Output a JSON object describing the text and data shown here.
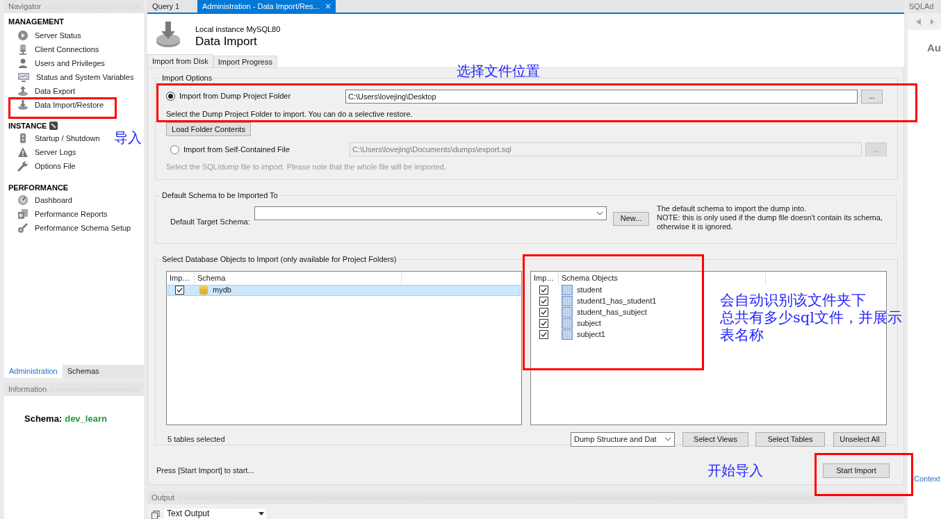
{
  "navigator": {
    "title": "Navigator",
    "sections": [
      {
        "title": "MANAGEMENT",
        "kind": "plain",
        "items": [
          {
            "label": "Server Status",
            "kind": "play"
          },
          {
            "label": "Client Connections",
            "kind": "connections"
          },
          {
            "label": "Users and Privileges",
            "kind": "user"
          },
          {
            "label": "Status and System Variables",
            "kind": "monitor"
          },
          {
            "label": "Data Export",
            "kind": "export"
          },
          {
            "label": "Data Import/Restore",
            "kind": "import"
          }
        ]
      },
      {
        "title": "INSTANCE",
        "kind": "instance",
        "items": [
          {
            "label": "Startup / Shutdown",
            "kind": "startup"
          },
          {
            "label": "Server Logs",
            "kind": "warning"
          },
          {
            "label": "Options File",
            "kind": "wrench"
          }
        ]
      },
      {
        "title": "PERFORMANCE",
        "kind": "plain",
        "items": [
          {
            "label": "Dashboard",
            "kind": "gauge"
          },
          {
            "label": "Performance Reports",
            "kind": "reports"
          },
          {
            "label": "Performance Schema Setup",
            "kind": "setup"
          }
        ]
      }
    ]
  },
  "sidebar_tabs": [
    {
      "label": "Administration",
      "selected": true
    },
    {
      "label": "Schemas",
      "selected": false
    }
  ],
  "information": {
    "title": "Information",
    "label": "Schema:",
    "value": "dev_learn"
  },
  "editor_tabs": [
    {
      "label": "Query 1",
      "selected": false,
      "closable": false
    },
    {
      "label": "Administration - Data Import/Res...",
      "selected": true,
      "closable": true
    }
  ],
  "page": {
    "instance": "Local instance MySQL80",
    "title": "Data Import"
  },
  "subtabs": [
    {
      "label": "Import from Disk",
      "selected": true
    },
    {
      "label": "Import Progress",
      "selected": false
    }
  ],
  "import_options": {
    "title": "Import Options",
    "options": [
      {
        "label": "Import from Dump Project Folder",
        "selected": true,
        "disabled": false,
        "path": "C:\\Users\\lovejing\\Desktop",
        "browse": "...",
        "hint": "Select the Dump Project Folder to import. You can do a selective restore.",
        "button": "Load Folder Contents"
      },
      {
        "label": "Import from Self-Contained File",
        "selected": false,
        "disabled": true,
        "path": "C:\\Users\\lovejing\\Documents\\dumps\\export.sql",
        "browse": "...",
        "hint": "Select the SQL/dump file to import. Please note that the whole file will be imported."
      }
    ]
  },
  "default_schema": {
    "title": "Default Schema to be Imported To",
    "label": "Default Target Schema:",
    "new_button": "New...",
    "note": [
      "The default schema to import the dump into.",
      "NOTE: this is only used if the dump file doesn't contain its schema,",
      "otherwise it is ignored."
    ]
  },
  "objects": {
    "title": "Select Database Objects to Import (only available for Project Folders)",
    "schemas": {
      "columns": [
        "Imp…",
        "Schema"
      ],
      "rows": [
        {
          "checked": true,
          "selected": true,
          "name": "mydb"
        }
      ]
    },
    "tables": {
      "columns": [
        "Imp…",
        "Schema Objects"
      ],
      "rows": [
        {
          "checked": true,
          "name": "student"
        },
        {
          "checked": true,
          "name": "student1_has_student1"
        },
        {
          "checked": true,
          "name": "student_has_subject"
        },
        {
          "checked": true,
          "name": "subject"
        },
        {
          "checked": true,
          "name": "subject1"
        }
      ]
    },
    "count": "5 tables selected",
    "dump_mode": "Dump Structure and Dat",
    "buttons": [
      "Select Views",
      "Select Tables",
      "Unselect All"
    ]
  },
  "status": "Press [Start Import] to start...",
  "start_button": "Start Import",
  "output": {
    "title": "Output",
    "mode": "Text Output"
  },
  "right_panel": {
    "title": "SQLAd",
    "heading": "Au",
    "footer": "Context"
  },
  "annotations": [
    {
      "lines": [
        "选择文件位置"
      ]
    },
    {
      "lines": [
        "导入"
      ]
    },
    {
      "lines": [
        "会自动识别该文件夹下",
        "总共有多少sql文件，并展示",
        "表名称"
      ]
    },
    {
      "lines": [
        "开始导入"
      ]
    }
  ]
}
